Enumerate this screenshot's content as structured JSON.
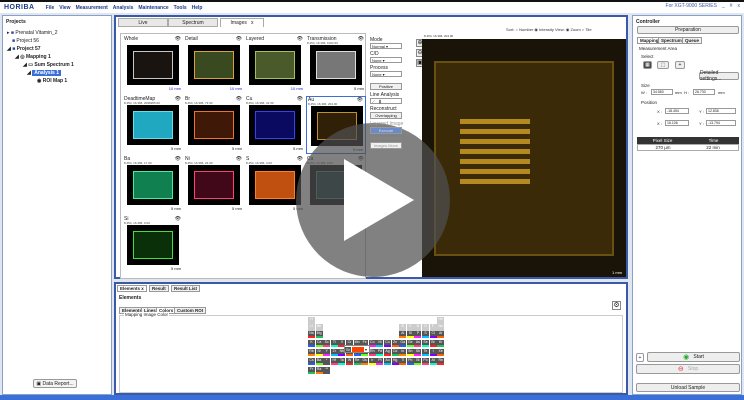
{
  "app": {
    "logo": "HORIBA",
    "menu": [
      "File",
      "View",
      "Measurement",
      "Analysis",
      "Maintenance",
      "Tools",
      "Help"
    ],
    "product": "For XGT-9000 SERIES",
    "window_controls": [
      "_",
      "#",
      "x"
    ]
  },
  "projects": {
    "title": "Projects",
    "tree": [
      "Prenatal Vitamin_2",
      "Project 56",
      "Project 57",
      "Mapping 1",
      "Sum Spectrum 1",
      "Analysis 1",
      "ROI Map 1"
    ],
    "data_report": "Data Report..."
  },
  "center": {
    "tabs": [
      "Live",
      "Spectrum",
      "Images",
      "x"
    ],
    "sort": "Sort:  ○ Number  ◉ Intensity   View:  ◉ Zoom  ○ Tile",
    "cells": [
      {
        "label": "Whole",
        "sub": "",
        "scale": "10 mm",
        "color": "#c8c8c8",
        "bg": "#1a1410"
      },
      {
        "label": "Detail",
        "sub": "",
        "scale": "10 mm",
        "color": "#d8a040",
        "bg": "#3a4a20"
      },
      {
        "label": "Layered",
        "sub": "",
        "scale": "10 mm",
        "color": "#a0c060",
        "bg": "#4a5a2a"
      },
      {
        "label": "Transmission",
        "sub": "8.454, 16.396,  1062.60",
        "scale": "5 mm",
        "color": "#ddd",
        "bg": "#777"
      },
      {
        "label": "DeadtimeMap",
        "sub": "8.454, 16.396,  2098265.00",
        "scale": "5 mm",
        "color": "#60e0f0",
        "bg": "#20a8c0"
      },
      {
        "label": "Br",
        "sub": "8.454, 16.396,  73.93",
        "scale": "5 mm",
        "color": "#f07030",
        "bg": "#401808"
      },
      {
        "label": "Cu",
        "sub": "8.454, 16.396,  31.50",
        "scale": "5 mm",
        "color": "#3040ff",
        "bg": "#0a0a60"
      },
      {
        "label": "Au",
        "sub": "8.454, 16.396,  204.00",
        "scale": "5 mm",
        "color": "#c09030",
        "bg": "#302008"
      },
      {
        "label": "Ba",
        "sub": "8.454, 16.396,  17.00",
        "scale": "5 mm",
        "color": "#40f0a0",
        "bg": "#108050"
      },
      {
        "label": "Ni",
        "sub": "8.454, 16.396,  24.00",
        "scale": "5 mm",
        "color": "#ff4070",
        "bg": "#400818"
      },
      {
        "label": "S",
        "sub": "8.454, 16.396,  3.00",
        "scale": "5 mm",
        "color": "#ff8020",
        "bg": "#c05010"
      },
      {
        "label": "Ca",
        "sub": "8.454, 16.396,  0.00",
        "scale": "5 mm",
        "color": "#408080",
        "bg": "#103030"
      },
      {
        "label": "Si",
        "sub": "8.454, 16.396,  0.00",
        "scale": "5 mm",
        "color": "#40e040",
        "bg": "#0a300a"
      }
    ],
    "controls": {
      "mode_label": "Mode",
      "mode": "Normal",
      "cd_label": "C/D",
      "cd": "None",
      "process_label": "Process",
      "process": "None",
      "positive": "Positive",
      "line_analysis": "Line Analysis",
      "reconstruct": "Reconstruct",
      "overlap": "Overlapping",
      "layered": "Layered Image",
      "execute": "Execute",
      "measurement": "Measurement",
      "images_move": "Images Move"
    },
    "big_coord": "8.454, 16.396,  204.00",
    "big_scale": "1 mm"
  },
  "bottom": {
    "tabs": [
      "Elements x",
      "Result",
      "Result List"
    ],
    "section": "Elements",
    "subtabs": [
      "Elements",
      "Lines",
      "Colors",
      "Custom ROI"
    ],
    "group": "Mapping Image Color",
    "selected_element": "Sr",
    "selected_color": "#ff4000",
    "rows": [
      [
        "H",
        "",
        "",
        "",
        "",
        "",
        "",
        "",
        "",
        "",
        "",
        "",
        "",
        "",
        "",
        "",
        "",
        "He"
      ],
      [
        "Li",
        "Be",
        "",
        "",
        "",
        "",
        "",
        "",
        "",
        "",
        "",
        "",
        "B",
        "C",
        "N",
        "O",
        "F",
        "Ne"
      ],
      [
        "Na",
        "Mg",
        "",
        "",
        "",
        "",
        "",
        "",
        "",
        "",
        "",
        "",
        "Al",
        "Si",
        "P",
        "S",
        "Cl",
        "Ar"
      ],
      [
        "K",
        "Ca",
        "Sc",
        "Ti",
        "V",
        "Cr",
        "Mn",
        "Fe",
        "Co",
        "Ni",
        "Cu",
        "Zn",
        "Ga",
        "Ge",
        "As",
        "Se",
        "Br",
        "Kr"
      ],
      [
        "Rb",
        "Sr",
        "Y",
        "Zr",
        "Nb",
        "Mo",
        "Tc",
        "Ru",
        "Rh",
        "Pd",
        "Ag",
        "Cd",
        "In",
        "Sn",
        "Sb",
        "Te",
        "I",
        "Xe"
      ],
      [
        "Cs",
        "Ba",
        "*",
        "Hf",
        "Ta",
        "W",
        "Re",
        "Os",
        "Ir",
        "Pt",
        "Au",
        "Hg",
        "Tl",
        "Pb",
        "Bi",
        "Po",
        "At",
        "Rn"
      ],
      [
        "Fr",
        "Ra",
        "**"
      ]
    ],
    "palette": [
      "#ff2020",
      "#20c060",
      "#ff8000",
      "#ffff00",
      "#ff20ff",
      "#00c0ff",
      "#8000ff",
      "#ff6000",
      "#2060ff",
      "#60ff20",
      "#ff4080",
      "#00ffc0"
    ]
  },
  "controller": {
    "title": "Controller",
    "preparation": "Preparation",
    "tabs": [
      "Mapping",
      "Spectrum",
      "Queue"
    ],
    "area": "Measurement Area",
    "select": "Select",
    "detailed": "Detailed settings...",
    "size": "Size",
    "w_label": "W :",
    "w": "34.560",
    "h_label": "H :",
    "h": "26.730",
    "unit": "mm",
    "position": "Position",
    "x_label": "X :",
    "y_label": "Y :",
    "x1": "-18.454",
    "y1": "12.836",
    "x2": "16.106",
    "y2": "-13.794",
    "pixel_size_h": "Pixel Size",
    "time_h": "Time",
    "pixel_size": "270  µm",
    "time": "22  min",
    "start": "Start",
    "stop": "Stop",
    "unload": "Unload Sample",
    "plus": "+"
  }
}
